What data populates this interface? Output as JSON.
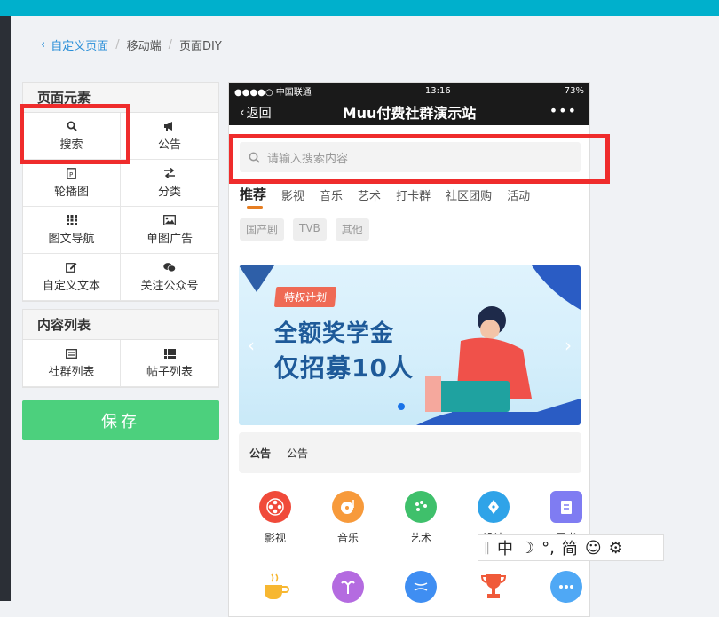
{
  "breadcrumb": {
    "back": "自定义页面",
    "sep1": "/",
    "mid": "移动端",
    "sep2": "/",
    "current": "页面DIY"
  },
  "elements_panel": {
    "title": "页面元素",
    "items": [
      {
        "label": "搜索",
        "icon": "search-icon"
      },
      {
        "label": "公告",
        "icon": "bullhorn-icon"
      },
      {
        "label": "轮播图",
        "icon": "carousel-icon"
      },
      {
        "label": "分类",
        "icon": "exchange-icon"
      },
      {
        "label": "图文导航",
        "icon": "grid-icon"
      },
      {
        "label": "单图广告",
        "icon": "image-icon"
      },
      {
        "label": "自定义文本",
        "icon": "edit-icon"
      },
      {
        "label": "关注公众号",
        "icon": "wechat-icon"
      }
    ]
  },
  "content_panel": {
    "title": "内容列表",
    "items": [
      {
        "label": "社群列表",
        "icon": "list-icon"
      },
      {
        "label": "帖子列表",
        "icon": "list-bullets-icon"
      }
    ]
  },
  "save_label": "保存",
  "phone": {
    "status": {
      "carrier": "●●●●○ 中国联通",
      "time": "13:16",
      "battery": "73%"
    },
    "nav": {
      "back": "返回",
      "title": "Muu付费社群演示站",
      "more": "•••"
    },
    "search_placeholder": "请输入搜索内容",
    "tabs": [
      "推荐",
      "影视",
      "音乐",
      "艺术",
      "打卡群",
      "社区团购",
      "活动"
    ],
    "subtags": [
      "国产剧",
      "TVB",
      "其他"
    ],
    "banner": {
      "badge": "特权计划",
      "line1": "全额奖学金",
      "line2": "仅招募10人"
    },
    "notice": {
      "label": "公告",
      "text": "公告"
    },
    "icons_row1": [
      {
        "label": "影视",
        "color": "#f04a3a"
      },
      {
        "label": "音乐",
        "color": "#f79a3b"
      },
      {
        "label": "艺术",
        "color": "#3fc06b"
      },
      {
        "label": "设计",
        "color": "#2fa3e8"
      },
      {
        "label": "图书",
        "color": "#7f7cf2"
      }
    ],
    "icons_row2": [
      {
        "color": "#f7b731"
      },
      {
        "color": "#b46be0"
      },
      {
        "color": "#3f8ef2"
      },
      {
        "color": "#f05a3a"
      },
      {
        "color": "#4fa8f5"
      }
    ]
  },
  "ime": {
    "grip": "‖",
    "lang": "中",
    "moon": "☽",
    "punct": "°,",
    "mode": "简",
    "emoji": "☺",
    "gear": "⚙"
  }
}
